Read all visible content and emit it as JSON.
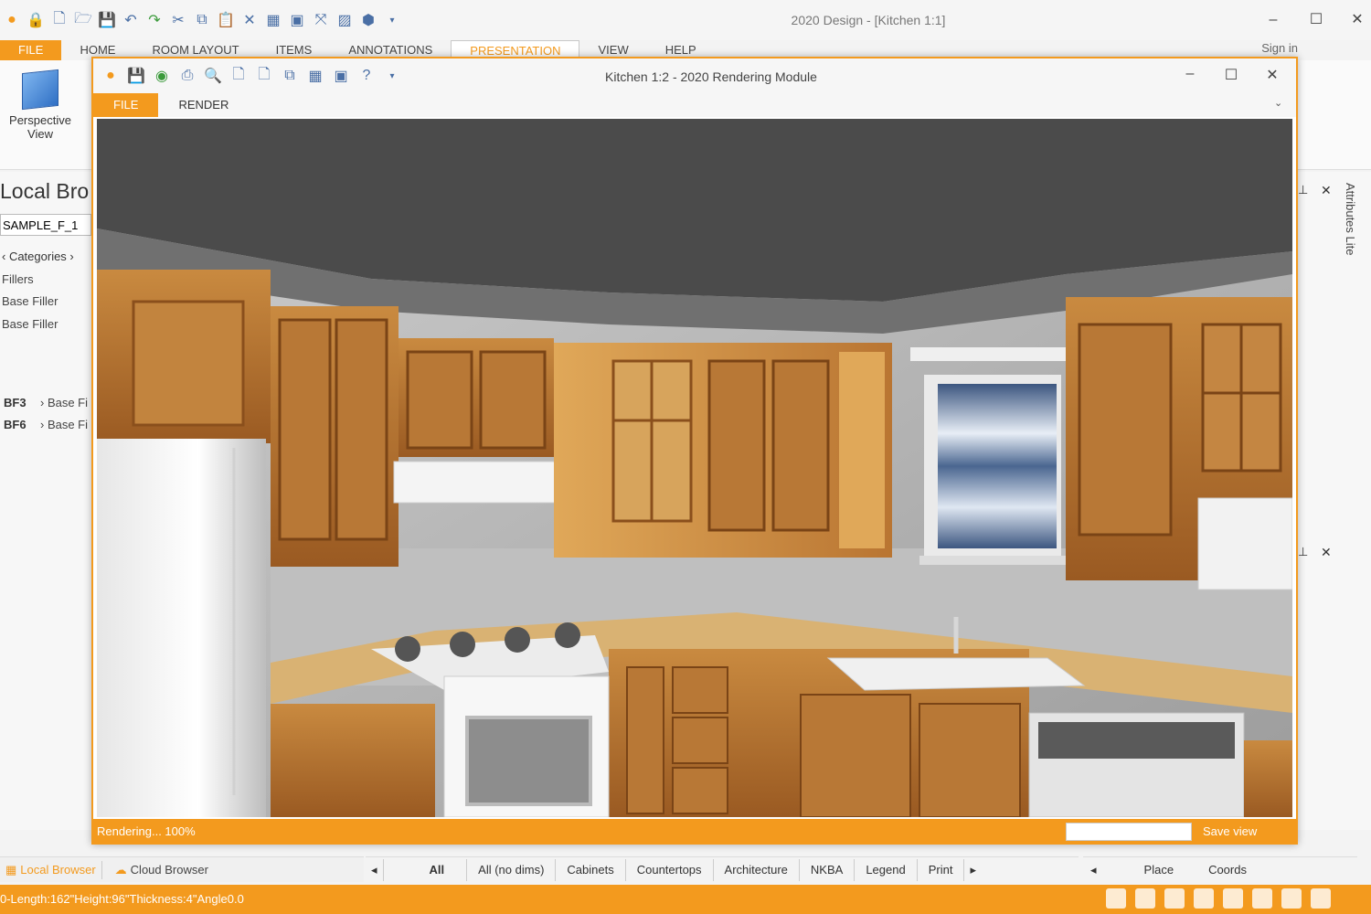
{
  "app": {
    "title": "2020 Design - [Kitchen 1:1]",
    "signin": "Sign in",
    "ribbon_tabs": [
      "FILE",
      "HOME",
      "ROOM LAYOUT",
      "ITEMS",
      "ANNOTATIONS",
      "PRESENTATION",
      "VIEW",
      "HELP"
    ],
    "active_tab": "PRESENTATION",
    "perspective_label": "Perspective View",
    "accent": "#f39a1e"
  },
  "left_pane": {
    "title": "Local Bro",
    "search_value": "SAMPLE_F_1",
    "categories": "‹ Categories ›",
    "items": [
      "Fillers",
      "Base Filler",
      "Base Filler"
    ],
    "codes": [
      {
        "code": "BF3",
        "label": "› Base Fi"
      },
      {
        "code": "BF6",
        "label": "› Base Fi"
      }
    ]
  },
  "right_pane": {
    "attributes_label": "Attributes Lite"
  },
  "render_window": {
    "title": "Kitchen 1:2 - 2020 Rendering Module",
    "tabs": [
      "FILE",
      "RENDER"
    ],
    "status": "Rendering... 100%",
    "save_view": "Save view"
  },
  "bottom": {
    "browser_tabs": [
      "Local Browser",
      "Cloud Browser"
    ],
    "filter_tabs": [
      "All",
      "All (no dims)",
      "Cabinets",
      "Countertops",
      "Architecture",
      "NKBA",
      "Legend",
      "Print"
    ],
    "place_tabs": [
      "Place",
      "Coords"
    ],
    "status_text": "0-Length:162\"Height:96\"Thickness:4\"Angle0.0"
  }
}
